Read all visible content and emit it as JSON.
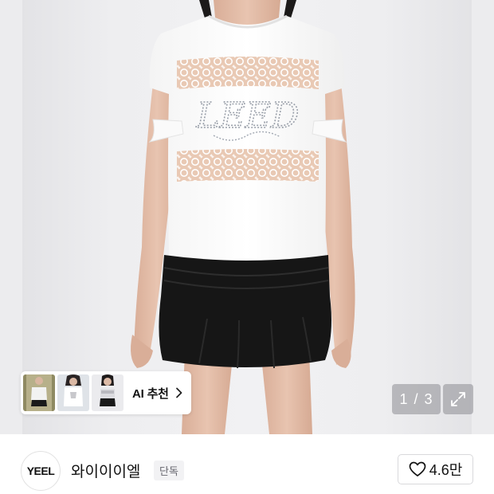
{
  "product_image": {
    "alt": "",
    "shirt_print": "LEED"
  },
  "recommendation": {
    "label": "AI 추천",
    "thumbnail_count": 3,
    "icon": "chevron-right-icon"
  },
  "pager": {
    "current": "1",
    "separator": "/",
    "total": "3"
  },
  "expand": {
    "icon": "expand-arrows-icon"
  },
  "brand": {
    "logo_text": "YEEL",
    "name": "와이이이엘",
    "badge": "단독"
  },
  "like": {
    "icon": "heart-outline-icon",
    "count": "4.6만"
  },
  "colors": {
    "pager_bg": "#8c8c91",
    "badge_bg": "#f2f2f4",
    "badge_text": "#66666e"
  }
}
